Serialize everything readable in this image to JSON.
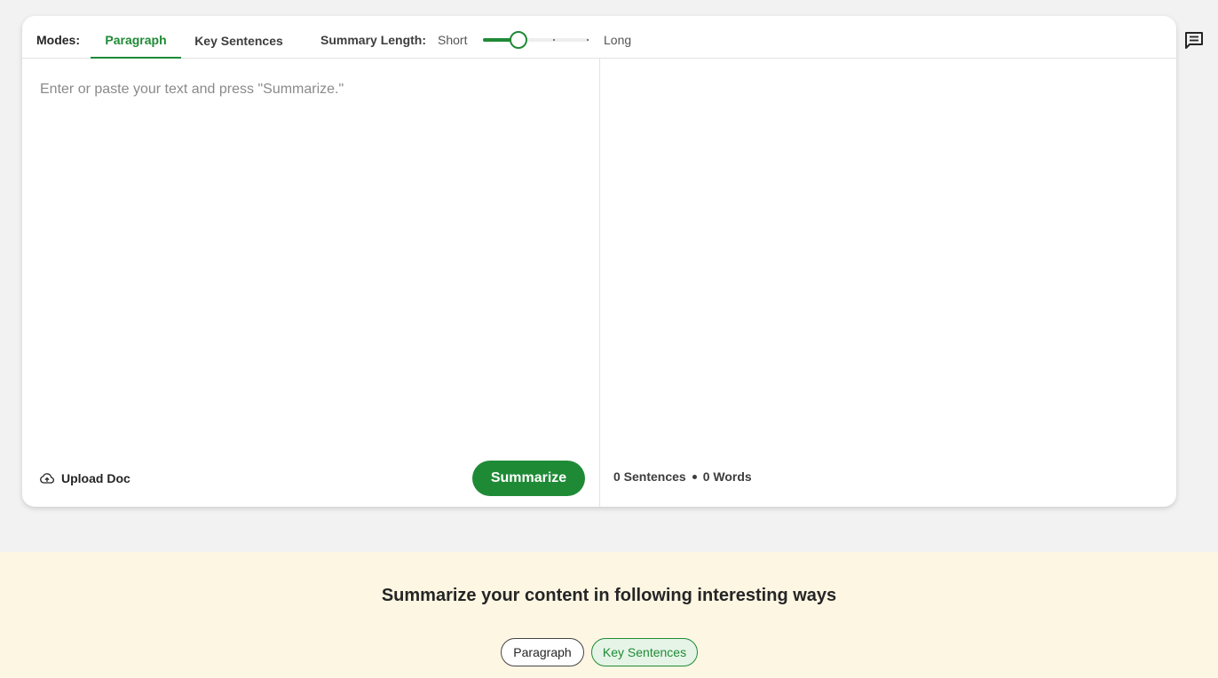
{
  "toolbar": {
    "modes_label": "Modes:",
    "tabs": [
      {
        "label": "Paragraph",
        "active": true
      },
      {
        "label": "Key Sentences",
        "active": false
      }
    ],
    "summary_length_label": "Summary Length:",
    "short_label": "Short",
    "long_label": "Long",
    "slider_value_fraction": 0.33
  },
  "input": {
    "placeholder": "Enter or paste your text and press \"Summarize.\""
  },
  "footer_left": {
    "upload_label": "Upload Doc",
    "upload_icon": "cloud-upload-icon",
    "summarize_label": "Summarize"
  },
  "footer_right": {
    "sentences": "0 Sentences",
    "words": "0 Words"
  },
  "side_icon": "feedback-icon",
  "promo": {
    "title": "Summarize your content in following interesting ways",
    "chips": [
      {
        "label": "Paragraph"
      },
      {
        "label": "Key Sentences"
      }
    ]
  },
  "colors": {
    "accent": "#1f8a36",
    "accent_light": "#e5f4e6",
    "page_bg": "#f2f2f2",
    "promo_bg": "#fdf6e3"
  }
}
